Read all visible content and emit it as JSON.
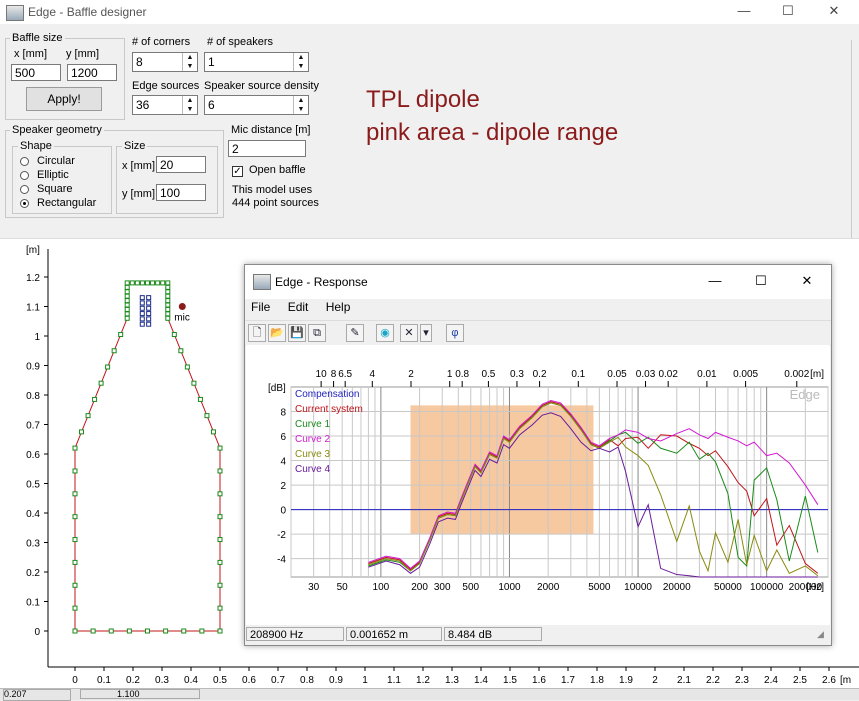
{
  "window": {
    "title": "Edge - Baffle designer",
    "min": "—",
    "max": "☐",
    "close": "✕"
  },
  "baffle": {
    "group": "Baffle size",
    "x_label": "x [mm]",
    "y_label": "y [mm]",
    "x": "500",
    "y": "1200",
    "apply": "Apply!"
  },
  "corners": {
    "label": "# of corners",
    "value": "8"
  },
  "speakers": {
    "label": "# of speakers",
    "value": "1"
  },
  "edge_sources": {
    "label": "Edge sources",
    "value": "36"
  },
  "density": {
    "label": "Speaker source density",
    "value": "6"
  },
  "annotation": {
    "line1": "TPL  dipole",
    "line2": "pink area - dipole range"
  },
  "geometry": {
    "group": "Speaker geometry",
    "shape_group": "Shape",
    "shapes": [
      {
        "label": "Circular",
        "selected": false
      },
      {
        "label": "Elliptic",
        "selected": false
      },
      {
        "label": "Square",
        "selected": false
      },
      {
        "label": "Rectangular",
        "selected": true
      }
    ],
    "size_group": "Size",
    "x_label": "x [mm]",
    "x": "20",
    "y_label": "y [mm]",
    "y": "100"
  },
  "mic": {
    "label": "Mic distance [m]",
    "value": "2",
    "open_baffle": "Open baffle",
    "open_baffle_checked": true,
    "info1": "This model uses",
    "info2": "444 point sources",
    "plot_label": "mic"
  },
  "baffle_plot": {
    "unit": "[m]",
    "yticks": [
      "1.2",
      "1.1",
      "1",
      "0.9",
      "0.8",
      "0.7",
      "0.6",
      "0.5",
      "0.4",
      "0.3",
      "0.2",
      "0.1",
      "0"
    ],
    "xticks": [
      "0",
      "0.1",
      "0.2",
      "0.3",
      "0.4",
      "0.5",
      "0.6",
      "0.7",
      "0.8",
      "0.9",
      "1",
      "1.1",
      "1.2",
      "1.3",
      "1.4",
      "1.5",
      "1.6",
      "1.7",
      "1.8",
      "1.9",
      "2",
      "2.1",
      "2.2",
      "2.3",
      "2.4",
      "2.5",
      "2.6"
    ],
    "x_unit": "[m"
  },
  "bottom_status": [
    "0.207",
    "1.100"
  ],
  "response": {
    "title": "Edge - Response",
    "min": "—",
    "max": "☐",
    "close": "✕",
    "menu": [
      "File",
      "Edit",
      "Help"
    ],
    "tools": [
      {
        "name": "new-file-icon",
        "glyph": "🗋"
      },
      {
        "name": "open-folder-icon",
        "glyph": "📂"
      },
      {
        "name": "save-icon",
        "glyph": "💾"
      },
      {
        "name": "copy-icon",
        "glyph": "⧉"
      },
      {
        "name": "pen-icon",
        "glyph": "✎"
      },
      {
        "name": "speaker-icon",
        "glyph": "◉"
      },
      {
        "name": "delete-icon",
        "glyph": "✕"
      },
      {
        "name": "dropdown-icon",
        "glyph": "▾"
      },
      {
        "name": "phase-icon",
        "glyph": "φ"
      }
    ],
    "status": {
      "freq": "208900 Hz",
      "wavelength": "0.001652 m",
      "level": "8.484 dB"
    },
    "watermark": "Edge",
    "colors": {
      "compensation": "#1f1fbf",
      "current": "#c0141a",
      "curve1": "#1a8a1a",
      "curve2": "#d21ad2",
      "curve3": "#8a8a10",
      "curve4": "#6a1a9a",
      "dipole": "#f7c9a0"
    }
  },
  "chart_data": {
    "type": "line",
    "title": "",
    "ylabel": "[dB]",
    "xlabel": "[Hz]",
    "xscale": "log",
    "xlim": [
      20,
      300000
    ],
    "ylim": [
      -5.5,
      10
    ],
    "x_ticks": [
      30,
      50,
      100,
      200,
      300,
      500,
      1000,
      2000,
      5000,
      10000,
      20000,
      50000,
      100000,
      200000
    ],
    "x_tick_labels": [
      "30",
      "50",
      "100",
      "200",
      "300",
      "500",
      "1000",
      "2000",
      "5000",
      "10000",
      "20000",
      "50000",
      "100000",
      "200000"
    ],
    "top_axis_unit": "[m]",
    "top_ticks": [
      "10",
      "8",
      "6.5",
      "4",
      "2",
      "1",
      "0.8",
      "0.5",
      "0.3",
      "0.2",
      "0.1",
      "0.05",
      "0.03",
      "0.02",
      "0.01",
      "0.005",
      "0.002"
    ],
    "y_ticks": [
      8,
      6,
      4,
      2,
      0,
      -2,
      -4
    ],
    "legend": [
      "Compensation",
      "Current system",
      "Curve 1",
      "Curve 2",
      "Curve 3",
      "Curve 4"
    ],
    "dipole_range_hz": [
      170,
      4500
    ],
    "dipole_range_db": [
      -2,
      8.5
    ],
    "series": [
      {
        "name": "Compensation",
        "color": "#1f1fbf",
        "x": [
          20,
          300000
        ],
        "y": [
          0,
          0
        ]
      },
      {
        "name": "Current system",
        "color": "#c0141a",
        "x": [
          80,
          110,
          140,
          170,
          200,
          240,
          280,
          330,
          380,
          420,
          480,
          540,
          600,
          700,
          800,
          900,
          1000,
          1200,
          1500,
          1800,
          2100,
          2500,
          3000,
          3600,
          4300,
          5000,
          6000,
          7000,
          8000,
          10000,
          12000,
          15000,
          20000,
          25000,
          30000,
          35000,
          40000,
          50000,
          60000,
          70000,
          80000,
          100000,
          120000,
          150000,
          200000,
          250000
        ],
        "y": [
          -4.4,
          -3.9,
          -4.1,
          -4.9,
          -4.3,
          -2.4,
          -0.6,
          -0.3,
          -0.4,
          0.8,
          2.3,
          3.6,
          3.1,
          4.6,
          4.3,
          5.9,
          5.6,
          6.7,
          7.6,
          8.5,
          8.8,
          8.6,
          7.7,
          6.6,
          5.4,
          5.1,
          5.7,
          5.2,
          5.8,
          5.9,
          5.0,
          6.1,
          6.0,
          5.4,
          5.0,
          4.4,
          4.8,
          3.5,
          2.2,
          1.5,
          -0.5,
          0.9,
          -2.9,
          -1.3,
          -4.4,
          -5.2
        ]
      },
      {
        "name": "Curve 1",
        "color": "#1a8a1a",
        "x": [
          80,
          110,
          140,
          170,
          200,
          240,
          280,
          330,
          380,
          420,
          480,
          540,
          600,
          700,
          800,
          900,
          1000,
          1200,
          1500,
          1800,
          2100,
          2500,
          3000,
          3600,
          4300,
          5000,
          6000,
          7000,
          8000,
          10000,
          12000,
          15000,
          20000,
          25000,
          30000,
          35000,
          40000,
          50000,
          60000,
          70000,
          80000,
          100000,
          120000,
          150000,
          200000,
          250000
        ],
        "y": [
          -4.6,
          -4.1,
          -4.3,
          -5.0,
          -4.4,
          -2.5,
          -0.7,
          -0.4,
          -0.5,
          0.7,
          2.2,
          3.5,
          3.0,
          4.5,
          4.2,
          5.8,
          5.5,
          6.6,
          7.5,
          8.4,
          8.7,
          8.5,
          7.6,
          6.5,
          5.3,
          5.0,
          5.6,
          6.1,
          6.3,
          5.4,
          5.9,
          5.0,
          4.6,
          5.5,
          4.1,
          4.6,
          3.9,
          1.3,
          -3.9,
          -4.6,
          2.4,
          3.4,
          0.8,
          -4.2,
          1.1,
          -3.5
        ]
      },
      {
        "name": "Curve 2",
        "color": "#d21ad2",
        "x": [
          80,
          110,
          140,
          170,
          200,
          240,
          280,
          330,
          380,
          420,
          480,
          540,
          600,
          700,
          800,
          900,
          1000,
          1200,
          1500,
          1800,
          2100,
          2500,
          3000,
          3600,
          4300,
          5000,
          6000,
          7000,
          8000,
          10000,
          12000,
          15000,
          20000,
          25000,
          30000,
          35000,
          40000,
          50000,
          60000,
          70000,
          80000,
          100000,
          120000,
          150000,
          200000,
          250000
        ],
        "y": [
          -4.3,
          -3.8,
          -4.0,
          -4.8,
          -4.2,
          -2.3,
          -0.5,
          -0.2,
          -0.3,
          0.9,
          2.4,
          3.7,
          3.2,
          4.7,
          4.4,
          6.0,
          5.7,
          6.8,
          7.7,
          8.6,
          8.9,
          8.7,
          7.8,
          6.7,
          5.5,
          5.2,
          5.8,
          6.1,
          6.5,
          6.3,
          5.8,
          5.6,
          6.2,
          6.6,
          6.1,
          5.8,
          6.3,
          5.9,
          5.6,
          5.2,
          5.5,
          4.4,
          4.6,
          3.8,
          2.0,
          0.4
        ]
      },
      {
        "name": "Curve 3",
        "color": "#8a8a10",
        "x": [
          80,
          110,
          140,
          170,
          200,
          240,
          280,
          330,
          380,
          420,
          480,
          540,
          600,
          700,
          800,
          900,
          1000,
          1200,
          1500,
          1800,
          2100,
          2500,
          3000,
          3600,
          4300,
          5000,
          6000,
          7000,
          8000,
          10000,
          12000,
          15000,
          20000,
          25000,
          30000,
          35000,
          40000,
          50000,
          60000,
          70000,
          80000,
          100000,
          120000,
          150000,
          200000,
          250000
        ],
        "y": [
          -4.5,
          -4.0,
          -4.2,
          -5.0,
          -4.4,
          -2.5,
          -0.7,
          -0.4,
          -0.5,
          0.7,
          2.2,
          3.5,
          3.0,
          4.5,
          4.2,
          5.8,
          5.5,
          6.6,
          7.5,
          8.4,
          8.7,
          8.5,
          7.6,
          6.5,
          5.3,
          5.0,
          5.5,
          5.9,
          5.1,
          4.4,
          3.6,
          1.2,
          -2.6,
          0.3,
          -3.4,
          -5.0,
          -1.9,
          -4.3,
          -0.8,
          -4.5,
          -2.1,
          -5.0,
          -3.3,
          -5.2,
          -4.6,
          -5.4
        ]
      },
      {
        "name": "Curve 4",
        "color": "#6a1a9a",
        "x": [
          80,
          110,
          140,
          170,
          200,
          240,
          280,
          330,
          380,
          420,
          480,
          540,
          600,
          700,
          800,
          900,
          1000,
          1200,
          1500,
          1800,
          2100,
          2500,
          3000,
          3600,
          4300,
          5000,
          6000,
          7000,
          8000,
          10000,
          12000,
          15000,
          20000,
          25000,
          30000,
          35000,
          40000,
          50000,
          60000,
          70000,
          80000,
          100000,
          120000,
          150000,
          200000,
          250000
        ],
        "y": [
          -4.7,
          -4.2,
          -4.5,
          -5.2,
          -4.7,
          -2.8,
          -1.0,
          -0.7,
          -0.8,
          0.4,
          1.9,
          3.2,
          2.7,
          4.1,
          3.8,
          5.3,
          5.0,
          6.1,
          6.9,
          7.7,
          7.9,
          7.6,
          6.6,
          5.5,
          4.8,
          5.0,
          4.7,
          5.1,
          3.1,
          -1.4,
          0.4,
          -4.8,
          -5.3,
          -5.4,
          -5.5,
          -5.5,
          -5.5,
          -5.5,
          -5.5,
          -5.5,
          -5.5,
          -5.5,
          -5.5,
          -5.5,
          -5.5,
          -5.5
        ]
      }
    ]
  }
}
